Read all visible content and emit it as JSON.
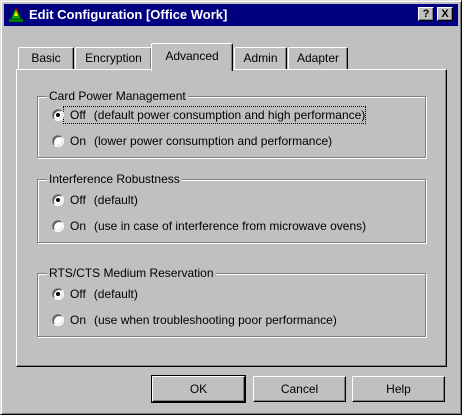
{
  "window": {
    "title": "Edit Configuration [Office Work]",
    "help_button": "?",
    "close_button": "X",
    "titlebar_color": "#000080",
    "face_color": "#c0c0c0"
  },
  "tabs": [
    {
      "label": "Basic",
      "active": false
    },
    {
      "label": "Encryption",
      "active": false
    },
    {
      "label": "Advanced",
      "active": true
    },
    {
      "label": "Admin",
      "active": false
    },
    {
      "label": "Adapter",
      "active": false
    }
  ],
  "groups": [
    {
      "title": "Card Power Management",
      "options": [
        {
          "label": "Off",
          "description": "(default power consumption and high performance)",
          "checked": true
        },
        {
          "label": "On",
          "description": "(lower power consumption and performance)",
          "checked": false
        }
      ]
    },
    {
      "title": "Interference Robustness",
      "options": [
        {
          "label": "Off",
          "description": "(default)",
          "checked": true
        },
        {
          "label": "On",
          "description": "(use in case of interference from microwave ovens)",
          "checked": false
        }
      ]
    },
    {
      "title": "RTS/CTS Medium Reservation",
      "options": [
        {
          "label": "Off",
          "description": "(default)",
          "checked": true
        },
        {
          "label": "On",
          "description": "(use when troubleshooting poor performance)",
          "checked": false
        }
      ]
    }
  ],
  "buttons": {
    "ok": "OK",
    "cancel": "Cancel",
    "help": "Help"
  }
}
